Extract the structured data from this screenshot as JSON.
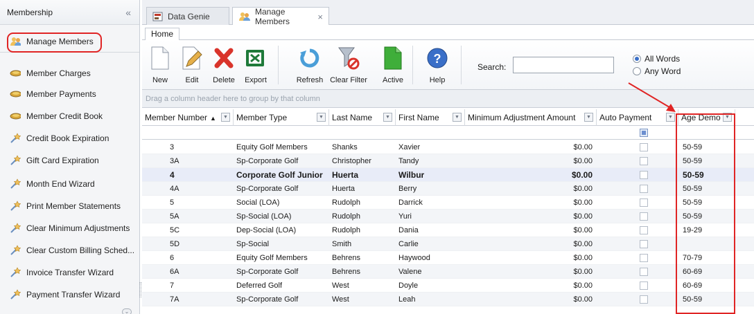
{
  "sidebar": {
    "title": "Membership",
    "collapse_icon": "«",
    "items": [
      {
        "label": "Manage Members",
        "icon": "people-icon"
      },
      {
        "label": "Member Charges",
        "icon": "coins-icon"
      },
      {
        "label": "Member Payments",
        "icon": "coins-icon"
      },
      {
        "label": "Member Credit Book",
        "icon": "coins-icon"
      },
      {
        "label": "Credit Book Expiration",
        "icon": "wizard-icon"
      },
      {
        "label": "Gift Card Expiration",
        "icon": "wizard-icon"
      },
      {
        "label": "Month End Wizard",
        "icon": "wizard-icon"
      },
      {
        "label": "Print Member Statements",
        "icon": "wizard-icon"
      },
      {
        "label": "Clear Minimum Adjustments",
        "icon": "wizard-icon"
      },
      {
        "label": "Clear Custom Billing Sched...",
        "icon": "wizard-icon"
      },
      {
        "label": "Invoice Transfer Wizard",
        "icon": "wizard-icon"
      },
      {
        "label": "Payment Transfer Wizard",
        "icon": "wizard-icon"
      }
    ]
  },
  "doc_tabs": [
    {
      "label": "Data Genie"
    },
    {
      "label": "Manage Members",
      "close": "×"
    }
  ],
  "ribbon": {
    "tab": "Home",
    "buttons": {
      "new": "New",
      "edit": "Edit",
      "delete": "Delete",
      "export": "Export",
      "refresh": "Refresh",
      "clear_filter": "Clear Filter",
      "active": "Active",
      "help": "Help"
    },
    "search_label": "Search:",
    "search_value": "",
    "radio_all": "All Words",
    "radio_any": "Any Word"
  },
  "group_panel": "Drag a column header here to group by that column",
  "columns": {
    "member_number": "Member Number",
    "member_type": "Member Type",
    "last_name": "Last Name",
    "first_name": "First Name",
    "min_adj": "Minimum Adjustment Amount",
    "auto_payment": "Auto Payment",
    "age_demo": "Age Demo"
  },
  "rows": [
    {
      "num": "3",
      "type": "Equity Golf Members",
      "last": "Shanks",
      "first": "Xavier",
      "amt": "$0.00",
      "age": "50-59"
    },
    {
      "num": "3A",
      "type": "Sp-Corporate Golf",
      "last": "Christopher",
      "first": "Tandy",
      "amt": "$0.00",
      "age": "50-59"
    },
    {
      "num": "4",
      "type": "Corporate Golf Junior",
      "last": "Huerta",
      "first": "Wilbur",
      "amt": "$0.00",
      "age": "50-59"
    },
    {
      "num": "4A",
      "type": "Sp-Corporate Golf",
      "last": "Huerta",
      "first": "Berry",
      "amt": "$0.00",
      "age": "50-59"
    },
    {
      "num": "5",
      "type": "Social (LOA)",
      "last": "Rudolph",
      "first": "Darrick",
      "amt": "$0.00",
      "age": "50-59"
    },
    {
      "num": "5A",
      "type": "Sp-Social (LOA)",
      "last": "Rudolph",
      "first": "Yuri",
      "amt": "$0.00",
      "age": "50-59"
    },
    {
      "num": "5C",
      "type": "Dep-Social (LOA)",
      "last": "Rudolph",
      "first": "Dania",
      "amt": "$0.00",
      "age": "19-29"
    },
    {
      "num": "5D",
      "type": "Sp-Social",
      "last": "Smith",
      "first": "Carlie",
      "amt": "$0.00",
      "age": ""
    },
    {
      "num": "6",
      "type": "Equity Golf Members",
      "last": "Behrens",
      "first": "Haywood",
      "amt": "$0.00",
      "age": "70-79"
    },
    {
      "num": "6A",
      "type": "Sp-Corporate Golf",
      "last": "Behrens",
      "first": "Valene",
      "amt": "$0.00",
      "age": "60-69"
    },
    {
      "num": "7",
      "type": "Deferred Golf",
      "last": "West",
      "first": "Doyle",
      "amt": "$0.00",
      "age": "60-69"
    },
    {
      "num": "7A",
      "type": "Sp-Corporate Golf",
      "last": "West",
      "first": "Leah",
      "amt": "$0.00",
      "age": "50-59"
    }
  ],
  "selected_row": 2,
  "colors": {
    "annotation": "#e02424",
    "selection": "#e8ecf8"
  }
}
